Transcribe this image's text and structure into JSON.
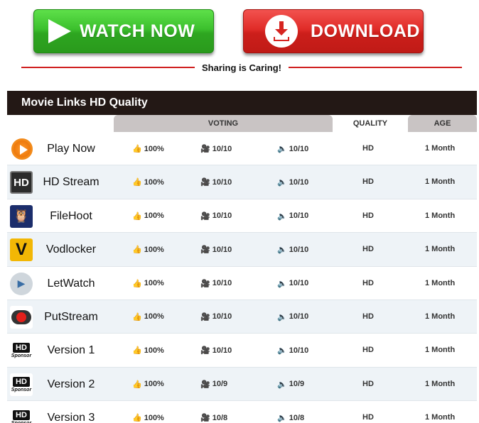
{
  "buttons": {
    "watch_label": "WATCH NOW",
    "download_label": "DOWNLOAD"
  },
  "share_text": "Sharing is Caring!",
  "panel": {
    "title": "Movie Links HD Quality",
    "headers": {
      "voting": "VOTING",
      "quality": "QUALITY",
      "age": "AGE"
    }
  },
  "rows": [
    {
      "name": "Play Now",
      "icon": "orange-play-icon",
      "like": "100%",
      "video": "10/10",
      "audio": "10/10",
      "quality": "HD",
      "age": "1 Month"
    },
    {
      "name": "HD Stream",
      "icon": "hd-stream-icon",
      "like": "100%",
      "video": "10/10",
      "audio": "10/10",
      "quality": "HD",
      "age": "1 Month"
    },
    {
      "name": "FileHoot",
      "icon": "owl-icon",
      "like": "100%",
      "video": "10/10",
      "audio": "10/10",
      "quality": "HD",
      "age": "1 Month"
    },
    {
      "name": "Vodlocker",
      "icon": "v-letter-icon",
      "like": "100%",
      "video": "10/10",
      "audio": "10/10",
      "quality": "HD",
      "age": "1 Month"
    },
    {
      "name": "LetWatch",
      "icon": "tv-play-icon",
      "like": "100%",
      "video": "10/10",
      "audio": "10/10",
      "quality": "HD",
      "age": "1 Month"
    },
    {
      "name": "PutStream",
      "icon": "putstream-icon",
      "like": "100%",
      "video": "10/10",
      "audio": "10/10",
      "quality": "HD",
      "age": "1 Month"
    },
    {
      "name": "Version 1",
      "icon": "hd-sponsor-icon",
      "like": "100%",
      "video": "10/10",
      "audio": "10/10",
      "quality": "HD",
      "age": "1 Month"
    },
    {
      "name": "Version 2",
      "icon": "hd-sponsor-icon",
      "like": "100%",
      "video": "10/9",
      "audio": "10/9",
      "quality": "HD",
      "age": "1 Month"
    },
    {
      "name": "Version 3",
      "icon": "hd-sponsor-icon",
      "like": "100%",
      "video": "10/8",
      "audio": "10/8",
      "quality": "HD",
      "age": "1 Month"
    }
  ],
  "icon_labels": {
    "hd": "HD",
    "v": "V",
    "sponsor": "Sponsor"
  },
  "colors": {
    "watch_green": "#3cc02d",
    "download_red": "#e02c28",
    "header_dark": "#231815",
    "share_line": "#d01f1f"
  }
}
